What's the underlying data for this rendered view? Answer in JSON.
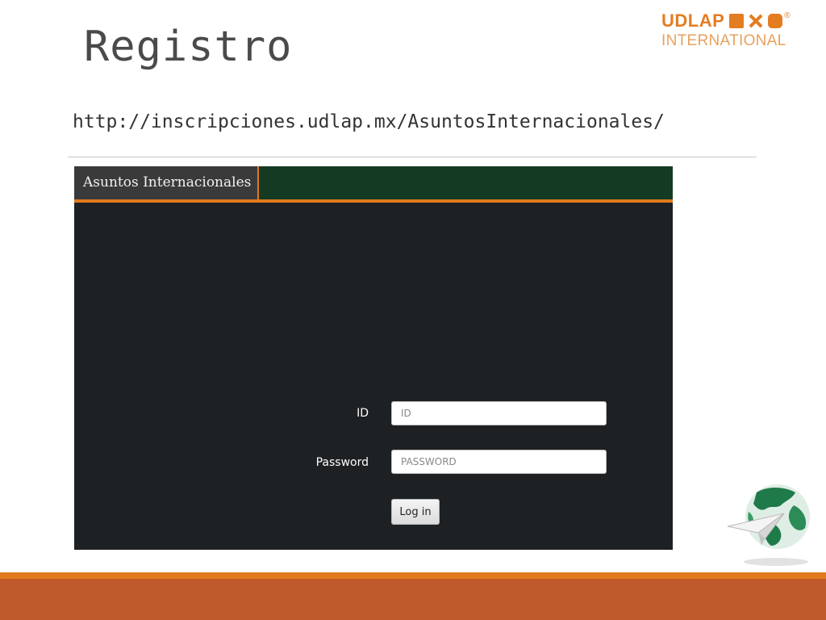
{
  "slide": {
    "title": "Registro",
    "url": "http://inscripciones.udlap.mx/AsuntosInternacionales/"
  },
  "logo": {
    "word": "UDLAP",
    "registered": "®",
    "subtitle": "INTERNATIONAL",
    "color": "#e47d22"
  },
  "app": {
    "brand": "Asuntos Internacionales",
    "header_color": "#143a24",
    "accent_color": "#e07a1e",
    "background_color": "#1e2124"
  },
  "login": {
    "id_label": "ID",
    "id_placeholder": "ID",
    "id_value": "",
    "password_label": "Password",
    "password_placeholder": "PASSWORD",
    "password_value": "",
    "submit_label": "Log in"
  },
  "decor": {
    "globe_icon": "globe-with-paper-plane-icon",
    "band_colors": [
      "#e07a1e",
      "#bf5a2c"
    ]
  }
}
